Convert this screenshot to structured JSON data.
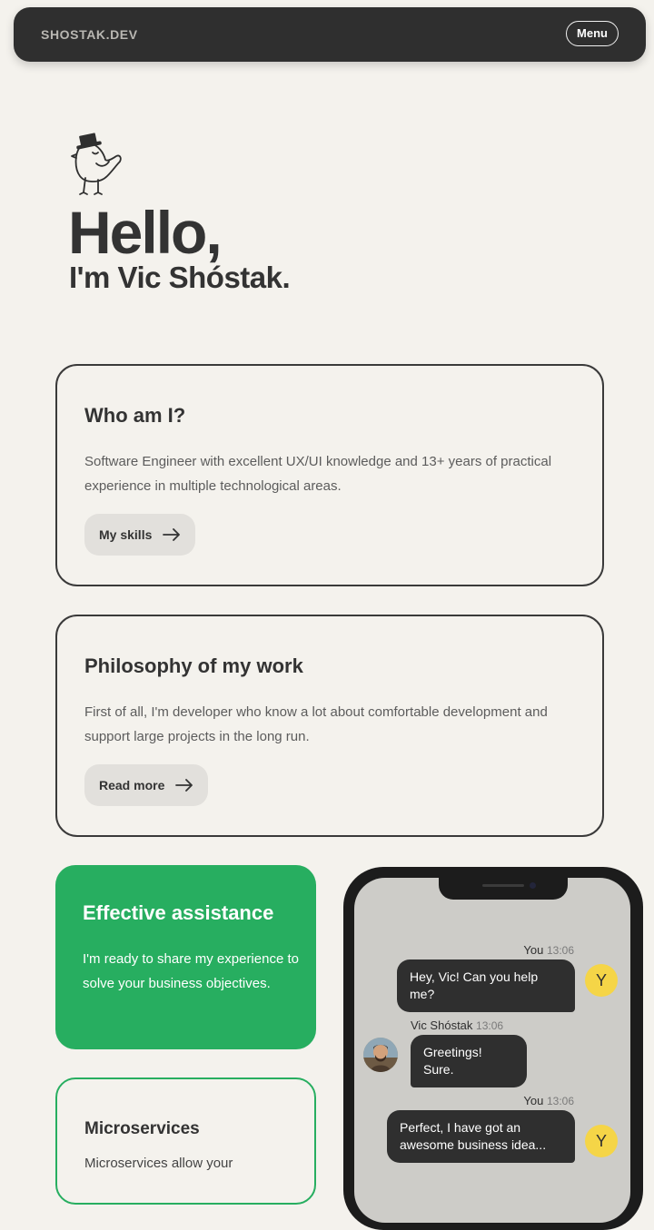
{
  "header": {
    "brand": "SHOSTAK.DEV",
    "menu_label": "Menu"
  },
  "hero": {
    "mascot_icon": "bird-with-top-hat-icon",
    "greeting": "Hello,",
    "intro": "I'm Vic Shóstak."
  },
  "cards": [
    {
      "title": "Who am I?",
      "text": "Software Engineer with excellent UX/UI knowledge and 13+ years of practical experience in multiple technological areas.",
      "button": "My skills",
      "button_icon": "arrow-right-icon"
    },
    {
      "title": "Philosophy of my work",
      "text": "First of all, I'm developer who know a lot about comfortable development and support large projects in the long run.",
      "button": "Read more",
      "button_icon": "arrow-right-icon"
    }
  ],
  "assistance": {
    "title": "Effective assistance",
    "text": "I'm ready to share my experience to solve your business objectives.",
    "color": "#27ae60"
  },
  "microservices": {
    "title": "Microservices",
    "text": "Microservices allow your"
  },
  "chat": {
    "messages": [
      {
        "author": "You",
        "time": "13:06",
        "text": "Hey, Vic! Can you help me?",
        "avatar": "Y"
      },
      {
        "author": "Vic Shóstak",
        "time": "13:06",
        "text": "Greetings! Sure."
      },
      {
        "author": "You",
        "time": "13:06",
        "text": "Perfect, I have got an awesome business idea...",
        "avatar": "Y"
      }
    ]
  }
}
